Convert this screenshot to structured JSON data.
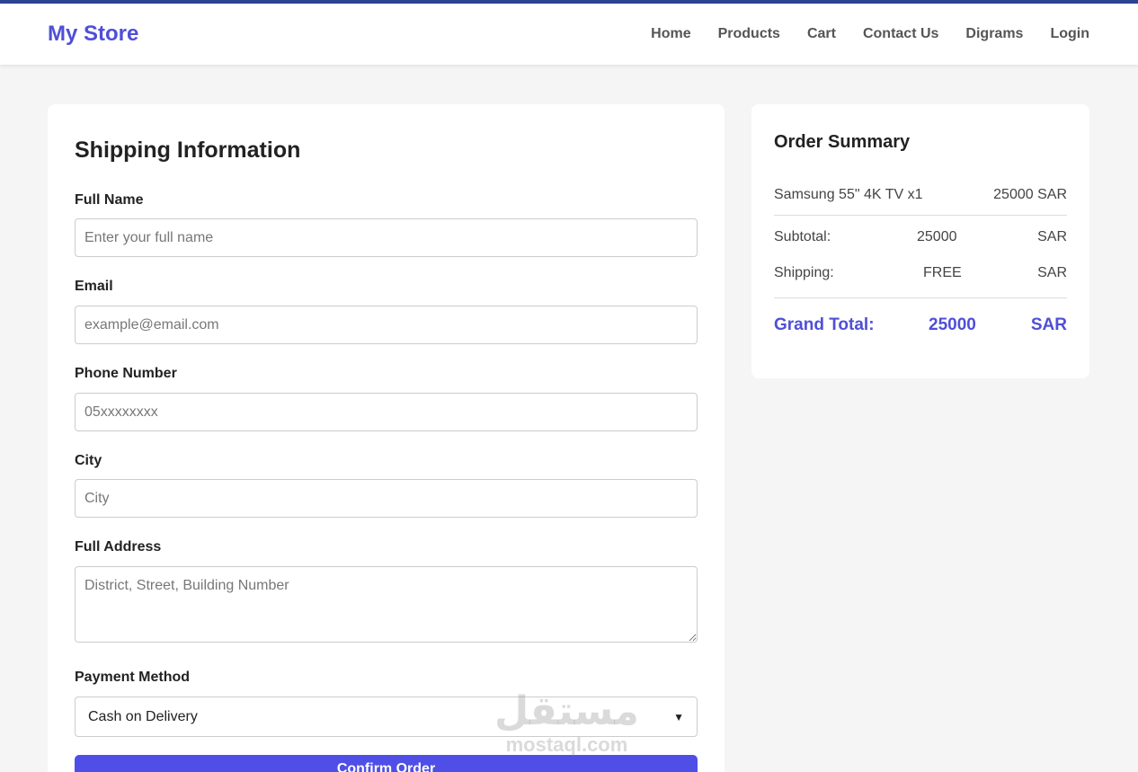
{
  "nav": {
    "logo": "My Store",
    "links": [
      "Home",
      "Products",
      "Cart",
      "Contact Us",
      "Digrams",
      "Login"
    ]
  },
  "form": {
    "title": "Shipping Information",
    "full_name": {
      "label": "Full Name",
      "placeholder": "Enter your full name"
    },
    "email": {
      "label": "Email",
      "placeholder": "example@email.com"
    },
    "phone": {
      "label": "Phone Number",
      "placeholder": "05xxxxxxxx"
    },
    "city": {
      "label": "City",
      "placeholder": "City"
    },
    "address": {
      "label": "Full Address",
      "placeholder": "District, Street, Building Number"
    },
    "payment": {
      "label": "Payment Method",
      "value": "Cash on Delivery"
    },
    "confirm_label": "Confirm Order"
  },
  "summary": {
    "title": "Order Summary",
    "item": {
      "name": "Samsung 55\" 4K TV x1",
      "price": "25000 SAR"
    },
    "subtotal": {
      "label": "Subtotal:",
      "value": "25000",
      "currency": "SAR"
    },
    "shipping": {
      "label": "Shipping:",
      "value": "FREE",
      "currency": "SAR"
    },
    "grand_total": {
      "label": "Grand Total:",
      "value": "25000",
      "currency": "SAR"
    }
  },
  "watermark": {
    "arabic": "مستقل",
    "latin": "mostaql.com"
  },
  "colors": {
    "accent": "#4f4fd8",
    "button": "#4f4fe8",
    "top_border": "#2c4394"
  }
}
